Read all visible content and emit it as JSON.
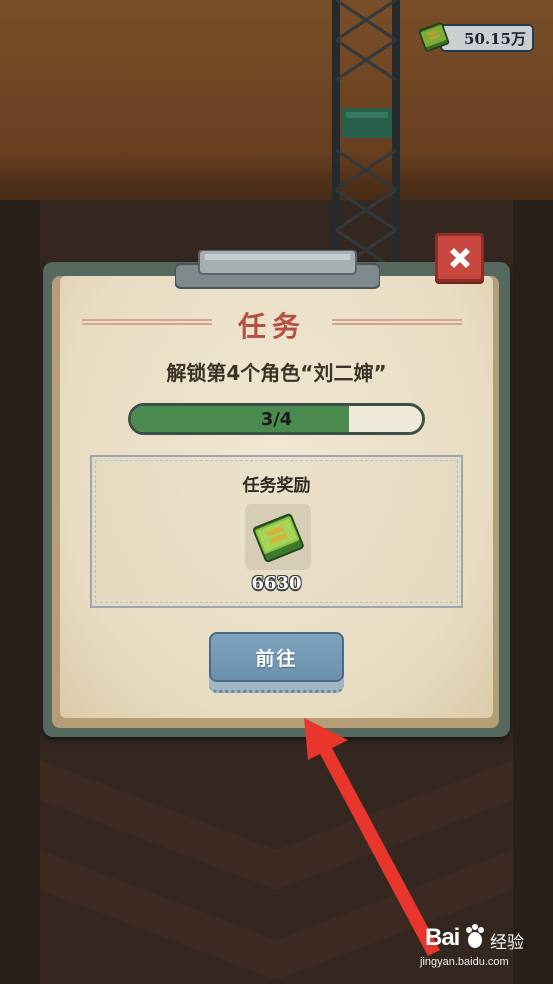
{
  "hud": {
    "money": "50.15万",
    "money_icon": "cash-stack-icon"
  },
  "dialog": {
    "title": "任务",
    "task_description": "解锁第4个角色“刘二婶”",
    "progress": {
      "text": "3/4",
      "current": 3,
      "total": 4,
      "fraction": 0.75
    },
    "reward_section_title": "任务奖励",
    "reward": {
      "icon": "cash-stack-icon",
      "value": "6630"
    },
    "go_button_label": "前往",
    "close_icon": "close-icon"
  },
  "watermark": {
    "brand": "Bai",
    "brand_suffix": "经验",
    "url": "jingyan.baidu.com"
  },
  "colors": {
    "title_red": "#b45145",
    "progress_green": "#4b8a4e",
    "button_blue": "#6a91ae",
    "close_red": "#c8473e",
    "arrow_red": "#e8362d"
  }
}
